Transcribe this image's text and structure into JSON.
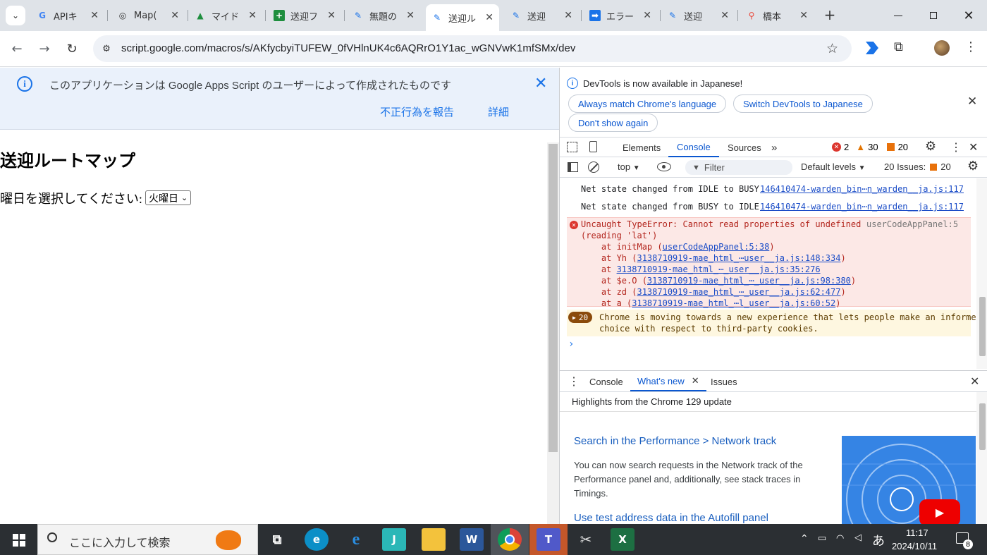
{
  "tabs": [
    {
      "label": "APIキ",
      "icon": "G",
      "color": "#4285f4"
    },
    {
      "label": "Map(",
      "icon": "◎",
      "color": "#333"
    },
    {
      "label": "マイド",
      "icon": "▲",
      "color": "#1e8e3e"
    },
    {
      "label": "送迎フ",
      "icon": "+",
      "color": "#fff"
    },
    {
      "label": "無題の",
      "icon": "✎",
      "color": "#1a73e8"
    },
    {
      "label": "送迎ル",
      "icon": "✎",
      "color": "#1a73e8"
    },
    {
      "label": "送迎",
      "icon": "✎",
      "color": "#1a73e8"
    },
    {
      "label": "エラー",
      "icon": "➡",
      "color": "#fff"
    },
    {
      "label": "送迎",
      "icon": "✎",
      "color": "#1a73e8"
    },
    {
      "label": "橋本",
      "icon": "⚲",
      "color": "#ea4335"
    }
  ],
  "url": "script.google.com/macros/s/AKfycbyiTUFEW_0fVHlnUK4c6AQRrO1Y1ac_wGNVwK1mfSMx/dev",
  "banner": {
    "text": "このアプリケーションは Google Apps Script のユーザーによって作成されたものです",
    "report": "不正行為を報告",
    "details": "詳細"
  },
  "page": {
    "title": "送迎ルートマップ",
    "day_label": "曜日を選択してください:",
    "day_value": "火曜日"
  },
  "devtools": {
    "info": "DevTools is now available in Japanese!",
    "btn_match": "Always match Chrome's language",
    "btn_switch": "Switch DevTools to Japanese",
    "btn_dont": "Don't show again",
    "tabs": [
      "Elements",
      "Console",
      "Sources"
    ],
    "errors": "2",
    "warnings": "30",
    "issues_count": "20",
    "context": "top",
    "filter_placeholder": "Filter",
    "levels": "Default levels",
    "issues_label": "20 Issues:",
    "issues_badge": "20"
  },
  "console": {
    "log1": "Net state changed from IDLE to BUSY",
    "log1_src": "146410474-warden_bin⋯n_warden__ja.js:117",
    "log2": "Net state changed from BUSY to IDLE",
    "log2_src": "146410474-warden_bin⋯n_warden__ja.js:117",
    "err_line1": "Uncaught TypeError: Cannot read properties of undefined",
    "err_line2": "(reading 'lat')",
    "err_src": "userCodeAppPanel:5",
    "stack": [
      {
        "prefix": "    at initMap (",
        "link": "userCodeAppPanel:5:38",
        "suffix": ")"
      },
      {
        "prefix": "    at Yh (",
        "link": "3138710919-mae_html_⋯user__ja.js:148:334",
        "suffix": ")"
      },
      {
        "prefix": "    at ",
        "link": "3138710919-mae_html_⋯_user__ja.js:35:276",
        "suffix": ""
      },
      {
        "prefix": "    at $e.O (",
        "link": "3138710919-mae_html_⋯_user__ja.js:98:380",
        "suffix": ")"
      },
      {
        "prefix": "    at zd (",
        "link": "3138710919-mae_html_⋯_user__ja.js:62:477",
        "suffix": ")"
      },
      {
        "prefix": "    at a (",
        "link": "3138710919-mae_html_⋯l_user__ja.js:60:52",
        "suffix": ")"
      }
    ],
    "warn_count": "20",
    "warn_line1": "Chrome is moving towards a new experience that lets people make an informed",
    "warn_line2": "choice with respect to third-party cookies."
  },
  "drawer": {
    "tabs": [
      "Console",
      "What's new",
      "Issues"
    ],
    "highlights": "Highlights from the Chrome 129 update",
    "item1_title": "Search in the Performance > Network track",
    "item1_desc": "You can now search requests in the Network track of the Performance panel and, additionally, see stack traces in Timings.",
    "item2_title": "Use test address data in the Autofill panel"
  },
  "taskbar": {
    "search": "ここに入力して検索",
    "time": "11:17",
    "date": "2024/10/11",
    "ime": "あ",
    "notif": "8"
  }
}
